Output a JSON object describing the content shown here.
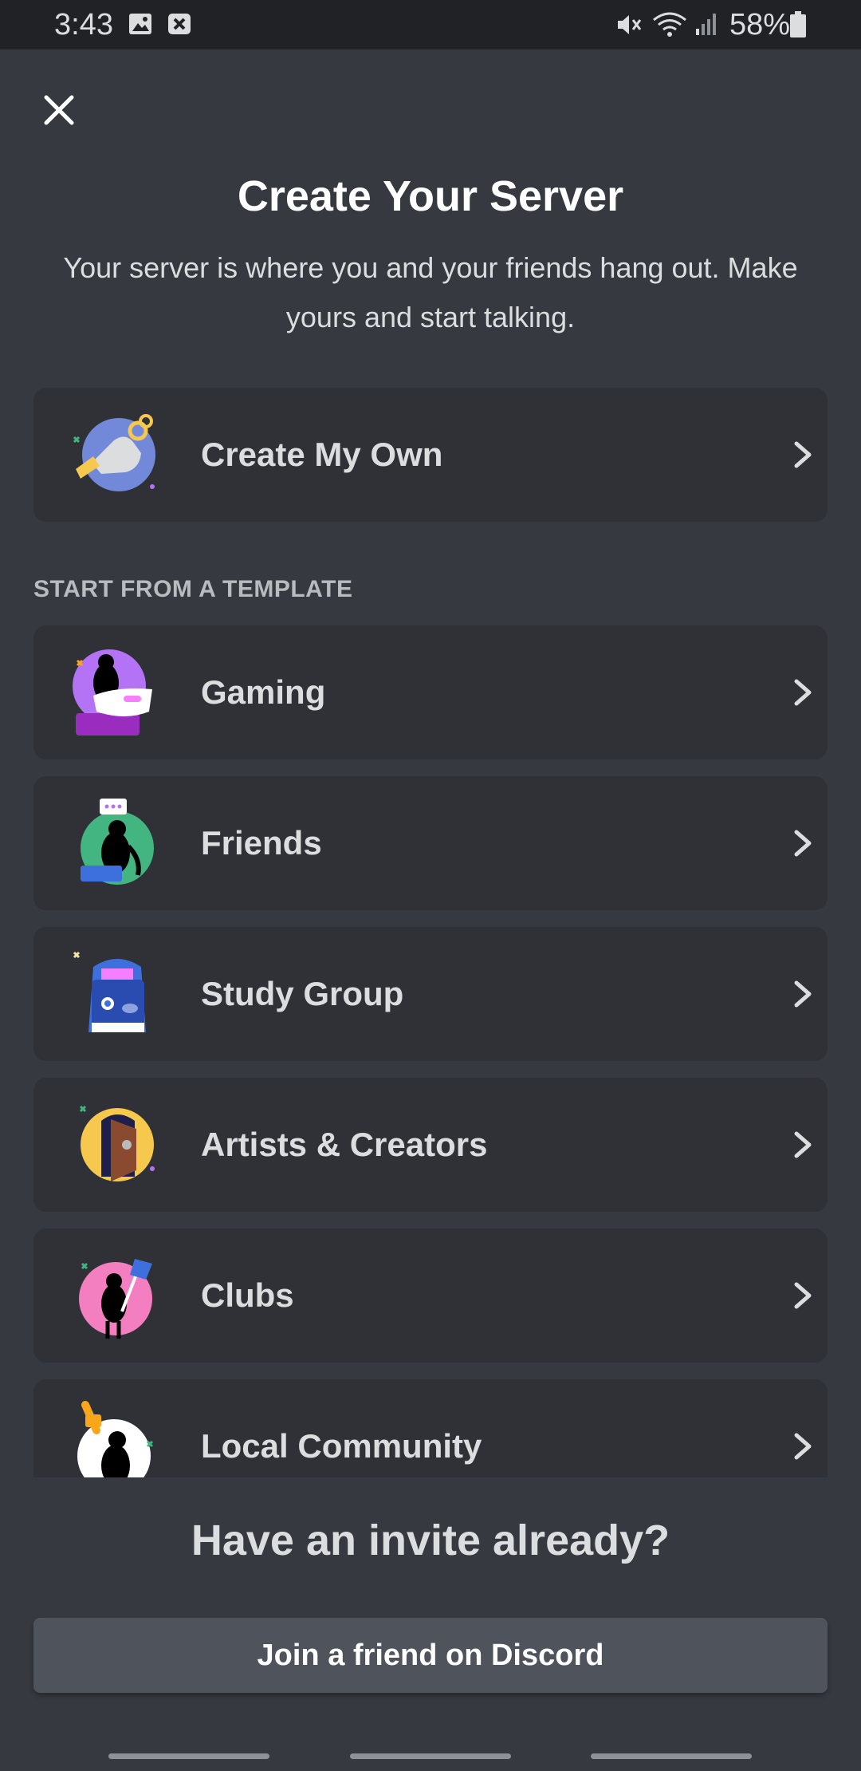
{
  "status_bar": {
    "time": "3:43",
    "battery": "58%",
    "left_icons": [
      "image-icon",
      "close-box-icon"
    ],
    "right_icons": [
      "mute-icon",
      "wifi-icon",
      "signal-icon",
      "battery-icon"
    ]
  },
  "header": {
    "close_icon": "close-icon",
    "title": "Create Your Server",
    "subtitle": "Your server is where you and your friends hang out. Make yours and start talking."
  },
  "create_own": {
    "label": "Create My Own",
    "icon": "hand-key-icon"
  },
  "templates": {
    "section_title": "START FROM A TEMPLATE",
    "items": [
      {
        "label": "Gaming",
        "icon": "gaming-icon"
      },
      {
        "label": "Friends",
        "icon": "friends-icon"
      },
      {
        "label": "Study Group",
        "icon": "backpack-icon"
      },
      {
        "label": "Artists & Creators",
        "icon": "door-icon"
      },
      {
        "label": "Clubs",
        "icon": "flag-icon"
      },
      {
        "label": "Local Community",
        "icon": "community-icon"
      }
    ]
  },
  "invite": {
    "title": "Have an invite already?",
    "button_label": "Join a friend on Discord"
  },
  "colors": {
    "background": "#36393f",
    "card": "#2f3136",
    "button": "#4f545c",
    "status_bar": "#202225"
  }
}
